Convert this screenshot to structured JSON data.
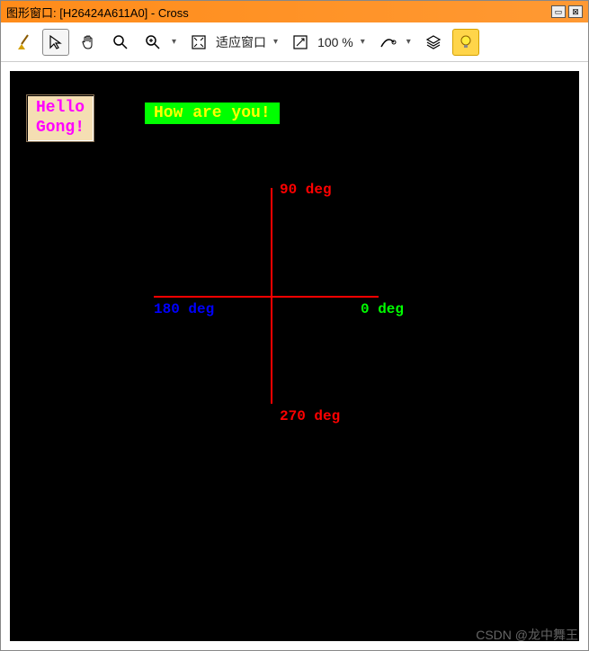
{
  "window": {
    "title": "图形窗口: [H26424A611A0] - Cross"
  },
  "toolbar": {
    "fit_label": "适应窗口",
    "zoom_value": "100 %"
  },
  "canvas": {
    "hello": "Hello\nGong!",
    "howare": "How are you!",
    "deg0": "0 deg",
    "deg90": "90 deg",
    "deg180": "180 deg",
    "deg270": "270 deg"
  },
  "watermark": "CSDN @龙中舞王"
}
